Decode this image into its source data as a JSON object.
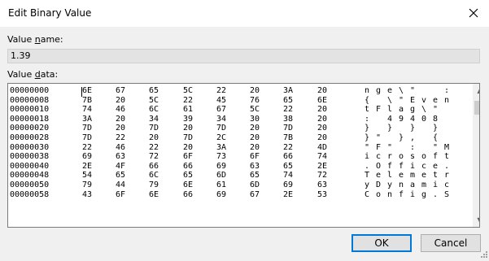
{
  "window": {
    "title": "Edit Binary Value"
  },
  "value_name": {
    "label_prefix": "Value ",
    "label_hotkey": "n",
    "label_suffix": "ame:",
    "value": "1.39"
  },
  "value_data": {
    "label_prefix": "Value ",
    "label_hotkey": "d",
    "label_suffix": "ata:"
  },
  "rows": [
    {
      "addr": "00000000",
      "bytes": [
        "6E",
        "67",
        "65",
        "5C",
        "22",
        "20",
        "3A",
        "20"
      ],
      "ascii": [
        "n",
        "g",
        "e",
        "\\",
        "\"",
        "",
        "",
        ":"
      ]
    },
    {
      "addr": "00000008",
      "bytes": [
        "7B",
        "20",
        "5C",
        "22",
        "45",
        "76",
        "65",
        "6E"
      ],
      "ascii": [
        "{",
        "",
        "\\",
        "\"",
        "E",
        "v",
        "e",
        "n"
      ]
    },
    {
      "addr": "00000010",
      "bytes": [
        "74",
        "46",
        "6C",
        "61",
        "67",
        "5C",
        "22",
        "20"
      ],
      "ascii": [
        "t",
        "F",
        "l",
        "a",
        "g",
        "\\",
        "\"",
        ""
      ]
    },
    {
      "addr": "00000018",
      "bytes": [
        "3A",
        "20",
        "34",
        "39",
        "34",
        "30",
        "38",
        "20"
      ],
      "ascii": [
        ":",
        "",
        "4",
        "9",
        "4",
        "0",
        "8",
        ""
      ]
    },
    {
      "addr": "00000020",
      "bytes": [
        "7D",
        "20",
        "7D",
        "20",
        "7D",
        "20",
        "7D",
        "20"
      ],
      "ascii": [
        "}",
        "",
        "}",
        "",
        "}",
        "",
        "}",
        ""
      ]
    },
    {
      "addr": "00000028",
      "bytes": [
        "7D",
        "22",
        "20",
        "7D",
        "2C",
        "20",
        "7B",
        "20"
      ],
      "ascii": [
        "}",
        "\"",
        "",
        "}",
        ",",
        "",
        "{",
        ""
      ]
    },
    {
      "addr": "00000030",
      "bytes": [
        "22",
        "46",
        "22",
        "20",
        "3A",
        "20",
        "22",
        "4D"
      ],
      "ascii": [
        "\"",
        "F",
        "\"",
        "",
        ":",
        "",
        "\"",
        "M"
      ]
    },
    {
      "addr": "00000038",
      "bytes": [
        "69",
        "63",
        "72",
        "6F",
        "73",
        "6F",
        "66",
        "74"
      ],
      "ascii": [
        "i",
        "c",
        "r",
        "o",
        "s",
        "o",
        "f",
        "t"
      ]
    },
    {
      "addr": "00000040",
      "bytes": [
        "2E",
        "4F",
        "66",
        "66",
        "69",
        "63",
        "65",
        "2E"
      ],
      "ascii": [
        ".",
        "O",
        "f",
        "f",
        "i",
        "c",
        "e",
        "."
      ]
    },
    {
      "addr": "00000048",
      "bytes": [
        "54",
        "65",
        "6C",
        "65",
        "6D",
        "65",
        "74",
        "72"
      ],
      "ascii": [
        "T",
        "e",
        "l",
        "e",
        "m",
        "e",
        "t",
        "r"
      ]
    },
    {
      "addr": "00000050",
      "bytes": [
        "79",
        "44",
        "79",
        "6E",
        "61",
        "6D",
        "69",
        "63"
      ],
      "ascii": [
        "y",
        "D",
        "y",
        "n",
        "a",
        "m",
        "i",
        "c"
      ]
    },
    {
      "addr": "00000058",
      "bytes": [
        "43",
        "6F",
        "6E",
        "66",
        "69",
        "67",
        "2E",
        "53"
      ],
      "ascii": [
        "C",
        "o",
        "n",
        "f",
        "i",
        "g",
        ".",
        "S"
      ]
    }
  ],
  "buttons": {
    "ok": "OK",
    "cancel": "Cancel"
  },
  "icons": {
    "close": "close-icon",
    "scroll_up": "scroll-up-icon",
    "scroll_down": "scroll-down-icon",
    "grip": "resize-grip-icon"
  },
  "colors": {
    "accent": "#0078d7",
    "readonly_bg": "#e3e3e3"
  }
}
